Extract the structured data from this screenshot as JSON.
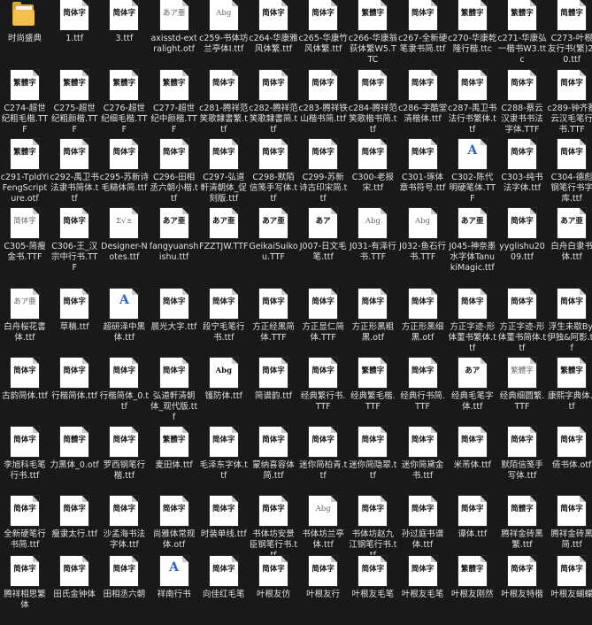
{
  "files": [
    {
      "name": "时尚盛典",
      "type": "folder"
    },
    {
      "name": "1.ttf",
      "glyph": "简体字"
    },
    {
      "name": "3.ttf",
      "glyph": "简体字"
    },
    {
      "name": "axisstd-extralight.otf",
      "glyph": "あア亜",
      "thin": true
    },
    {
      "name": "c259-书体坊兰亭体I.ttf",
      "glyph": "Abg",
      "thin": true
    },
    {
      "name": "c264-华康雅风体繁.ttf",
      "glyph": "简体字"
    },
    {
      "name": "c265-华康竹风体繁.ttf",
      "glyph": "简体字"
    },
    {
      "name": "c266-华康翁荻体繁W5.TTC",
      "glyph": "繁體字"
    },
    {
      "name": "c267-全新硬笔隶书简.ttf",
      "glyph": "简体字"
    },
    {
      "name": "c270-华康乾隆行楷.ttc",
      "glyph": "繁體字"
    },
    {
      "name": "c271-华康弘一楷书W3.ttc",
      "glyph": "繁體字"
    },
    {
      "name": "C273-叶根友行书(繁)2.0.ttf",
      "glyph": "简體字"
    },
    {
      "name": "C274-超世纪粗毛楷.TTF",
      "glyph": "繁體字"
    },
    {
      "name": "C275-超世纪粗颜楷.TTF",
      "glyph": "繁體字"
    },
    {
      "name": "C276-超世纪细毛楷.TTF",
      "glyph": "繁體字"
    },
    {
      "name": "C277-超世纪中颜楷.TTF",
      "glyph": "繁體字"
    },
    {
      "name": "c281-腾祥范笑歌隸書繁.ttf",
      "glyph": "简体字"
    },
    {
      "name": "c282-腾祥范笑歌隸書简.ttf",
      "glyph": "简体字"
    },
    {
      "name": "c283-腾祥铁山楷书简.ttf",
      "glyph": "简体字"
    },
    {
      "name": "c284-腾祥范笑歌楷书简.ttf",
      "glyph": "简体字"
    },
    {
      "name": "c286-字酷堂清楷体.ttf",
      "glyph": "简体字"
    },
    {
      "name": "c287-禹卫书法行书繁体.ttf",
      "glyph": "简体字"
    },
    {
      "name": "C288-蔡云汉隶书书法字体.TTF",
      "glyph": "简体字"
    },
    {
      "name": "c289-钟齐蔡云汉毛笔行书.TTF",
      "glyph": "简体字"
    },
    {
      "name": "c291-TpldYiFengScripture.otf",
      "glyph": "繁體字"
    },
    {
      "name": "c292-禹卫书法隶书简体.ttf",
      "glyph": "简体字"
    },
    {
      "name": "c295-苏新诗毛糙体简.ttf",
      "glyph": "简体字"
    },
    {
      "name": "C296-田相丞六朝小楷.ttf",
      "glyph": "简体字"
    },
    {
      "name": "C297-弘道軒清朝体_促刻版.ttf",
      "glyph": "简体字"
    },
    {
      "name": "C298-默陌信笺手写体.ttf",
      "glyph": "简体字"
    },
    {
      "name": "C299-苏新诗古印宋简.ttf",
      "glyph": "简体字"
    },
    {
      "name": "C300-老报宋.ttf",
      "glyph": "简体字"
    },
    {
      "name": "C301-琢体章书符号.ttf",
      "glyph": "简体字"
    },
    {
      "name": "C302-陈代明硬笔体.TTF",
      "glyph": "A",
      "blue": true
    },
    {
      "name": "C303-纯书法字体.ttf",
      "glyph": "简体字"
    },
    {
      "name": "C304-德彪钢笔行书字库.ttf",
      "glyph": "简体字"
    },
    {
      "name": "C305-简瘦金书.TTF",
      "glyph": "简体字",
      "thin": true
    },
    {
      "name": "C306-王_汉宗中行书.TTF",
      "glyph": "简体字"
    },
    {
      "name": "Designer-Notes.ttf",
      "glyph": "Σ√±",
      "thin": true
    },
    {
      "name": "fangyuanshishu.ttf",
      "glyph": "あア亜"
    },
    {
      "name": "FZZTJW.TTF",
      "glyph": "あア亜"
    },
    {
      "name": "GeikaiSuikou.TTF",
      "glyph": "あア亜"
    },
    {
      "name": "J007-日文毛笔.ttf",
      "glyph": "あア"
    },
    {
      "name": "J031-有泽行书.TTF",
      "glyph": "Abg",
      "thin": true
    },
    {
      "name": "J032-鱼石行书.TTF",
      "glyph": "Abg",
      "thin": true
    },
    {
      "name": "J045-神奈墨水字体TanukiMagic.ttf",
      "glyph": "あア亜"
    },
    {
      "name": "yyglishu2009.ttf",
      "glyph": "简体字"
    },
    {
      "name": "白舟白隶书体.ttf",
      "glyph": "あア亜"
    },
    {
      "name": "白舟桜花書体.ttf",
      "glyph": "あア亜",
      "thin": true
    },
    {
      "name": "草稿.ttf",
      "glyph": "简体字"
    },
    {
      "name": "超研泽中黑体.ttf",
      "glyph": "A",
      "blue": true
    },
    {
      "name": "晨光大字.ttf",
      "glyph": "简体字"
    },
    {
      "name": "段宁毛笔行书.ttf",
      "glyph": "简体字"
    },
    {
      "name": "方正经黑简体.TTF",
      "glyph": "简体字"
    },
    {
      "name": "方正显仁简体.TTF",
      "glyph": "简体字"
    },
    {
      "name": "方正形黑粗黑.otf",
      "glyph": "简体字"
    },
    {
      "name": "方正形黑细黑.otf",
      "glyph": "简体字"
    },
    {
      "name": "方正字迹-形体董书繁体.ttf",
      "glyph": "简体字"
    },
    {
      "name": "方正字迹-形体董书简体.ttf",
      "glyph": "简体字"
    },
    {
      "name": "浮生未歇By: 伊独&阿影.ttf",
      "glyph": "简体字"
    },
    {
      "name": "古韵简体.ttf",
      "glyph": "简体字"
    },
    {
      "name": "行楷简体.ttf",
      "glyph": "简体字"
    },
    {
      "name": "行楷简体_0.ttf",
      "glyph": "简体字"
    },
    {
      "name": "弘道軒清朝体_现代版.ttf",
      "glyph": "简体字"
    },
    {
      "name": "镬防体.ttf",
      "glyph": "Abg"
    },
    {
      "name": "简谱韵.ttf",
      "glyph": "简体字"
    },
    {
      "name": "经典繁行书.TTF",
      "glyph": "简体字"
    },
    {
      "name": "经典繁毛楷.TTF",
      "glyph": "繁體字"
    },
    {
      "name": "经典行书简.TTF",
      "glyph": "简体字"
    },
    {
      "name": "经典毛笔字体.ttf",
      "glyph": "あア"
    },
    {
      "name": "经典细圆繁.TTF",
      "glyph": "繁體字",
      "thin": true
    },
    {
      "name": "康熙字典体.ttf",
      "glyph": "繁體字"
    },
    {
      "name": "李旭科毛笔行书.ttf",
      "glyph": "简体字"
    },
    {
      "name": "力黑体_0.otf",
      "glyph": "简體字"
    },
    {
      "name": "罗西钢笔行楷.ttf",
      "glyph": "简体字"
    },
    {
      "name": "麦田体.ttf",
      "glyph": "繁體字"
    },
    {
      "name": "毛泽东字体.ttf",
      "glyph": "简体字"
    },
    {
      "name": "蒙纳喜容体简.ttf",
      "glyph": "简体字"
    },
    {
      "name": "迷你简柏青.ttf",
      "glyph": "简体字"
    },
    {
      "name": "迷你简隐翠.ttf",
      "glyph": "简体字"
    },
    {
      "name": "迷你简黛金书.ttf",
      "glyph": "简体字"
    },
    {
      "name": "米芾体.ttf",
      "glyph": "简体字"
    },
    {
      "name": "默陌信笺手写体.ttf",
      "glyph": "简体字"
    },
    {
      "name": "倩书体.otf",
      "glyph": "简体字"
    },
    {
      "name": "全新硬笔行书简.ttf",
      "glyph": "简体字"
    },
    {
      "name": "瘦隶太行.ttf",
      "glyph": "简体字"
    },
    {
      "name": "沙孟海书法字体.ttf",
      "glyph": "简体字"
    },
    {
      "name": "尚雅体常规体.otf",
      "glyph": "简体字"
    },
    {
      "name": "时装单线.ttf",
      "glyph": "简体字"
    },
    {
      "name": "书体坊安景臣钢笔行书.ttf",
      "glyph": "简体字"
    },
    {
      "name": "书体坊兰亭体.ttf",
      "glyph": "Abg",
      "thin": true
    },
    {
      "name": "书体坊赵九江钢笔行书.ttf",
      "glyph": "简体字"
    },
    {
      "name": "孙过庭书谱体.ttf",
      "glyph": "简体字"
    },
    {
      "name": "谭体.ttf",
      "glyph": "简体字"
    },
    {
      "name": "腾祥金砖黑繁.ttf",
      "glyph": "简體字"
    },
    {
      "name": "腾祥金砖黑简.ttf",
      "glyph": "简体字"
    },
    {
      "name": "腾祥相思繁体",
      "glyph": "简体字"
    },
    {
      "name": "田氏金钟体",
      "glyph": "简体字"
    },
    {
      "name": "田相丞六朝",
      "glyph": "简体字"
    },
    {
      "name": "祥南行书",
      "glyph": "A",
      "blue": true
    },
    {
      "name": "向佳红毛笔",
      "glyph": "简体字"
    },
    {
      "name": "叶根友仿",
      "glyph": "简体字"
    },
    {
      "name": "叶根友行",
      "glyph": "简体字"
    },
    {
      "name": "叶根友毛笔",
      "glyph": "简体字"
    },
    {
      "name": "叶根友毛笔",
      "glyph": "简体字"
    },
    {
      "name": "叶根友刚然",
      "glyph": "繁體字"
    },
    {
      "name": "叶根友特楷",
      "glyph": "简体字"
    },
    {
      "name": "叶根友蝴蝶",
      "glyph": "简体字"
    }
  ]
}
